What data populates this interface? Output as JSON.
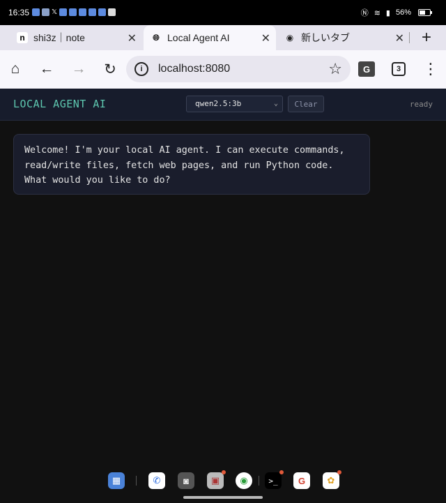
{
  "status_bar": {
    "time": "16:35",
    "battery_percent": "56%",
    "notification_icons": [
      "link-icon",
      "shop-icon",
      "x-icon",
      "snowflake-icon",
      "gear-icon",
      "chat-icon",
      "phone-icon",
      "calendar-icon",
      "square-icon"
    ]
  },
  "tabs": [
    {
      "title": "shi3z｜note",
      "favicon": "n",
      "active": false
    },
    {
      "title": "Local Agent AI",
      "favicon": "globe-icon",
      "active": true
    },
    {
      "title": "新しいタブ",
      "favicon": "chrome-icon",
      "active": false
    }
  ],
  "toolbar": {
    "url": "localhost:8080",
    "tab_count": "3"
  },
  "app": {
    "title": "LOCAL AGENT AI",
    "model_selected": "qwen2.5:3b",
    "clear_label": "Clear",
    "status": "ready"
  },
  "messages": [
    {
      "role": "assistant",
      "text": "Welcome! I'm your local AI agent. I can execute commands, read/write files, fetch web pages, and run Python code. What would you like to do?"
    }
  ],
  "dock": [
    "apps-icon",
    "phone-icon",
    "camera-icon",
    "store-icon",
    "chrome-icon",
    "terminal-icon",
    "google-icon",
    "photos-icon"
  ],
  "colors": {
    "accent": "#5ec8b0",
    "app_header_bg": "#171c2c",
    "chat_bg": "#111111",
    "bubble_bg": "#1a1d2c"
  }
}
